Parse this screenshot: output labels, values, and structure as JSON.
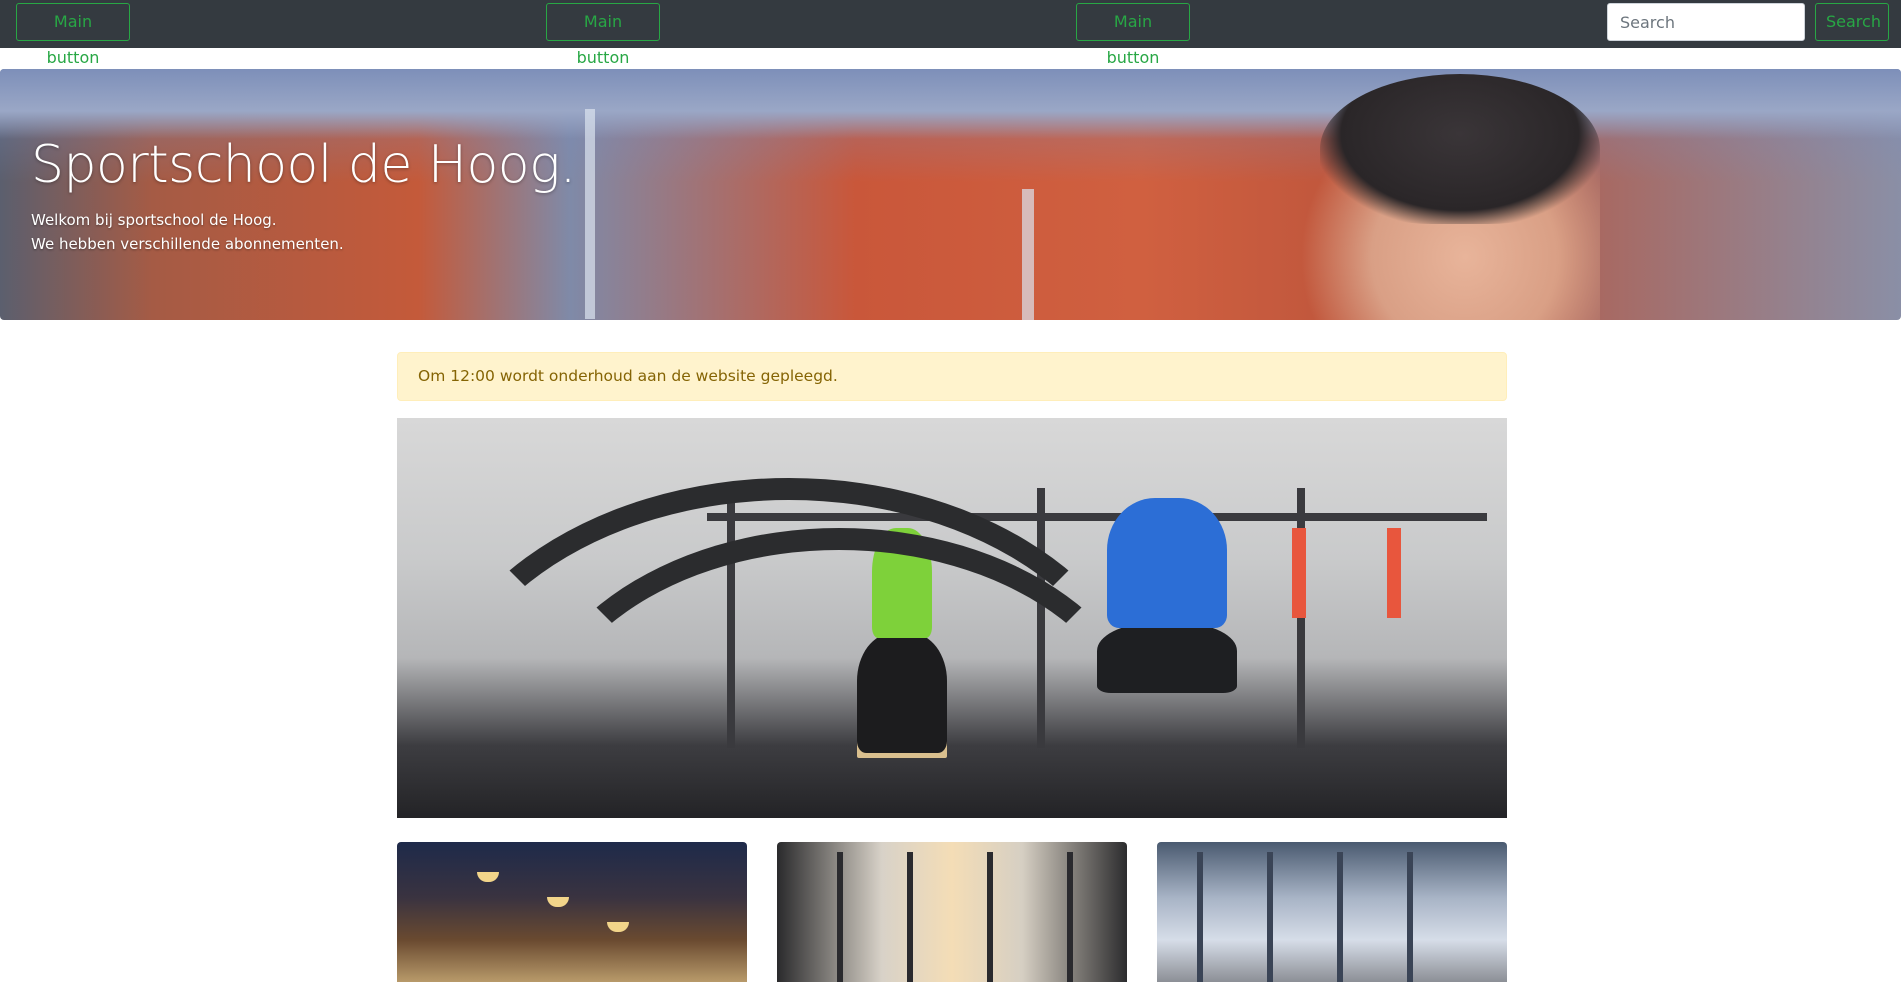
{
  "navbar": {
    "buttons": [
      "Main button",
      "Main button",
      "Main button"
    ],
    "search": {
      "placeholder": "Search",
      "button_label": "Search"
    },
    "colors": {
      "background": "#343a40",
      "accent": "#28a745"
    }
  },
  "hero": {
    "title": "Sportschool de Hoog.",
    "lines": [
      "Welkom bij sportschool de Hoog.",
      "We hebben verschillende abonnementen."
    ]
  },
  "alert": {
    "text": "Om 12:00 wordt onderhoud aan de website gepleegd.",
    "colors": {
      "background": "#fff3cd",
      "text": "#856404"
    }
  },
  "images": {
    "main": "battle-ropes-photo",
    "cards": [
      "gym-interior-photo",
      "treadmills-sunlight-photo",
      "gym-equipment-hall-photo"
    ]
  }
}
